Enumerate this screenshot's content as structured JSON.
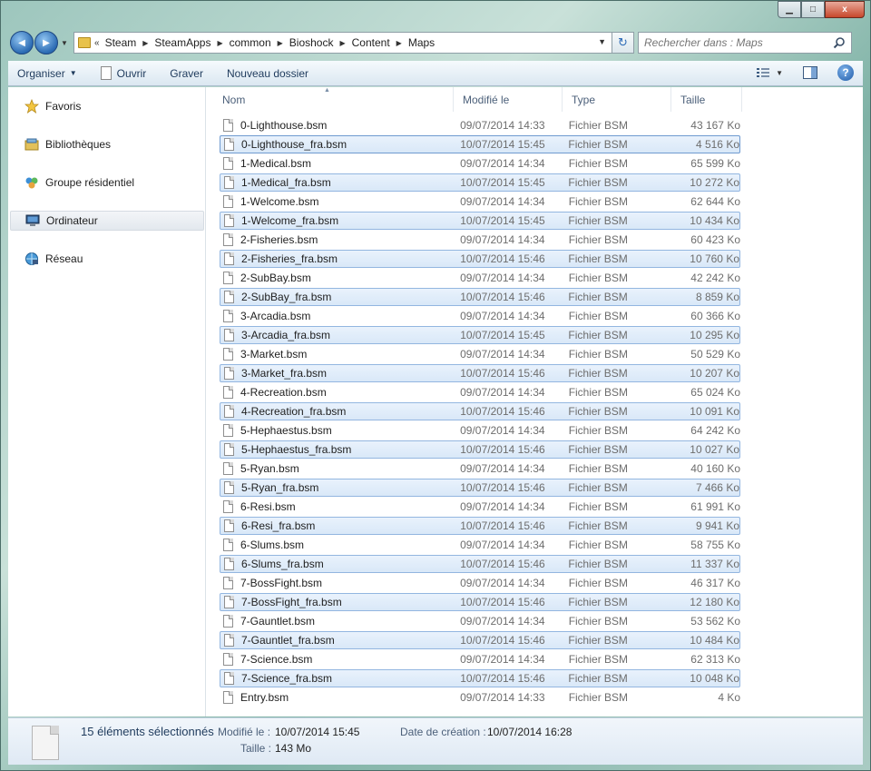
{
  "window": {
    "minimize_glyph": "▁",
    "maximize_glyph": "□",
    "close_glyph": "x"
  },
  "nav": {
    "back_glyph": "◀",
    "forward_glyph": "▶",
    "history_glyph": "▼",
    "breadcrumb_lead": "«",
    "breadcrumb": [
      "Steam",
      "SteamApps",
      "common",
      "Bioshock",
      "Content",
      "Maps"
    ],
    "refresh_glyph": "↻"
  },
  "search": {
    "placeholder": "Rechercher dans : Maps"
  },
  "toolbar": {
    "organize": "Organiser",
    "open": "Ouvrir",
    "burn": "Graver",
    "new_folder": "Nouveau dossier",
    "help_glyph": "?"
  },
  "sidebar": {
    "items": [
      {
        "label": "Favoris",
        "icon": "star-icon"
      },
      {
        "label": "Bibliothèques",
        "icon": "library-icon"
      },
      {
        "label": "Groupe résidentiel",
        "icon": "homegroup-icon"
      },
      {
        "label": "Ordinateur",
        "icon": "computer-icon"
      },
      {
        "label": "Réseau",
        "icon": "network-icon"
      }
    ]
  },
  "columns": {
    "name": "Nom",
    "modified": "Modifié le",
    "type": "Type",
    "size": "Taille"
  },
  "files": [
    {
      "name": "0-Lighthouse.bsm",
      "date": "09/07/2014 14:33",
      "type": "Fichier BSM",
      "size": "43 167 Ko",
      "selected": false
    },
    {
      "name": "0-Lighthouse_fra.bsm",
      "date": "10/07/2014 15:45",
      "type": "Fichier BSM",
      "size": "4 516 Ko",
      "selected": true
    },
    {
      "name": "1-Medical.bsm",
      "date": "09/07/2014 14:34",
      "type": "Fichier BSM",
      "size": "65 599 Ko",
      "selected": false
    },
    {
      "name": "1-Medical_fra.bsm",
      "date": "10/07/2014 15:45",
      "type": "Fichier BSM",
      "size": "10 272 Ko",
      "selected": true
    },
    {
      "name": "1-Welcome.bsm",
      "date": "09/07/2014 14:34",
      "type": "Fichier BSM",
      "size": "62 644 Ko",
      "selected": false
    },
    {
      "name": "1-Welcome_fra.bsm",
      "date": "10/07/2014 15:45",
      "type": "Fichier BSM",
      "size": "10 434 Ko",
      "selected": true
    },
    {
      "name": "2-Fisheries.bsm",
      "date": "09/07/2014 14:34",
      "type": "Fichier BSM",
      "size": "60 423 Ko",
      "selected": false
    },
    {
      "name": "2-Fisheries_fra.bsm",
      "date": "10/07/2014 15:46",
      "type": "Fichier BSM",
      "size": "10 760 Ko",
      "selected": true
    },
    {
      "name": "2-SubBay.bsm",
      "date": "09/07/2014 14:34",
      "type": "Fichier BSM",
      "size": "42 242 Ko",
      "selected": false
    },
    {
      "name": "2-SubBay_fra.bsm",
      "date": "10/07/2014 15:46",
      "type": "Fichier BSM",
      "size": "8 859 Ko",
      "selected": true
    },
    {
      "name": "3-Arcadia.bsm",
      "date": "09/07/2014 14:34",
      "type": "Fichier BSM",
      "size": "60 366 Ko",
      "selected": false
    },
    {
      "name": "3-Arcadia_fra.bsm",
      "date": "10/07/2014 15:45",
      "type": "Fichier BSM",
      "size": "10 295 Ko",
      "selected": true
    },
    {
      "name": "3-Market.bsm",
      "date": "09/07/2014 14:34",
      "type": "Fichier BSM",
      "size": "50 529 Ko",
      "selected": false
    },
    {
      "name": "3-Market_fra.bsm",
      "date": "10/07/2014 15:46",
      "type": "Fichier BSM",
      "size": "10 207 Ko",
      "selected": true
    },
    {
      "name": "4-Recreation.bsm",
      "date": "09/07/2014 14:34",
      "type": "Fichier BSM",
      "size": "65 024 Ko",
      "selected": false
    },
    {
      "name": "4-Recreation_fra.bsm",
      "date": "10/07/2014 15:46",
      "type": "Fichier BSM",
      "size": "10 091 Ko",
      "selected": true
    },
    {
      "name": "5-Hephaestus.bsm",
      "date": "09/07/2014 14:34",
      "type": "Fichier BSM",
      "size": "64 242 Ko",
      "selected": false
    },
    {
      "name": "5-Hephaestus_fra.bsm",
      "date": "10/07/2014 15:46",
      "type": "Fichier BSM",
      "size": "10 027 Ko",
      "selected": true
    },
    {
      "name": "5-Ryan.bsm",
      "date": "09/07/2014 14:34",
      "type": "Fichier BSM",
      "size": "40 160 Ko",
      "selected": false
    },
    {
      "name": "5-Ryan_fra.bsm",
      "date": "10/07/2014 15:46",
      "type": "Fichier BSM",
      "size": "7 466 Ko",
      "selected": true
    },
    {
      "name": "6-Resi.bsm",
      "date": "09/07/2014 14:34",
      "type": "Fichier BSM",
      "size": "61 991 Ko",
      "selected": false
    },
    {
      "name": "6-Resi_fra.bsm",
      "date": "10/07/2014 15:46",
      "type": "Fichier BSM",
      "size": "9 941 Ko",
      "selected": true
    },
    {
      "name": "6-Slums.bsm",
      "date": "09/07/2014 14:34",
      "type": "Fichier BSM",
      "size": "58 755 Ko",
      "selected": false
    },
    {
      "name": "6-Slums_fra.bsm",
      "date": "10/07/2014 15:46",
      "type": "Fichier BSM",
      "size": "11 337 Ko",
      "selected": true
    },
    {
      "name": "7-BossFight.bsm",
      "date": "09/07/2014 14:34",
      "type": "Fichier BSM",
      "size": "46 317 Ko",
      "selected": false
    },
    {
      "name": "7-BossFight_fra.bsm",
      "date": "10/07/2014 15:46",
      "type": "Fichier BSM",
      "size": "12 180 Ko",
      "selected": true
    },
    {
      "name": "7-Gauntlet.bsm",
      "date": "09/07/2014 14:34",
      "type": "Fichier BSM",
      "size": "53 562 Ko",
      "selected": false
    },
    {
      "name": "7-Gauntlet_fra.bsm",
      "date": "10/07/2014 15:46",
      "type": "Fichier BSM",
      "size": "10 484 Ko",
      "selected": true
    },
    {
      "name": "7-Science.bsm",
      "date": "09/07/2014 14:34",
      "type": "Fichier BSM",
      "size": "62 313 Ko",
      "selected": false
    },
    {
      "name": "7-Science_fra.bsm",
      "date": "10/07/2014 15:46",
      "type": "Fichier BSM",
      "size": "10 048 Ko",
      "selected": true
    },
    {
      "name": "Entry.bsm",
      "date": "09/07/2014 14:33",
      "type": "Fichier BSM",
      "size": "4 Ko",
      "selected": false
    }
  ],
  "details": {
    "count": "15 éléments sélectionnés",
    "modified_label": "Modifié le :",
    "modified_value": "10/07/2014 15:45",
    "created_label": "Date de création :",
    "created_value": "10/07/2014 16:28",
    "size_label": "Taille :",
    "size_value": "143 Mo"
  }
}
